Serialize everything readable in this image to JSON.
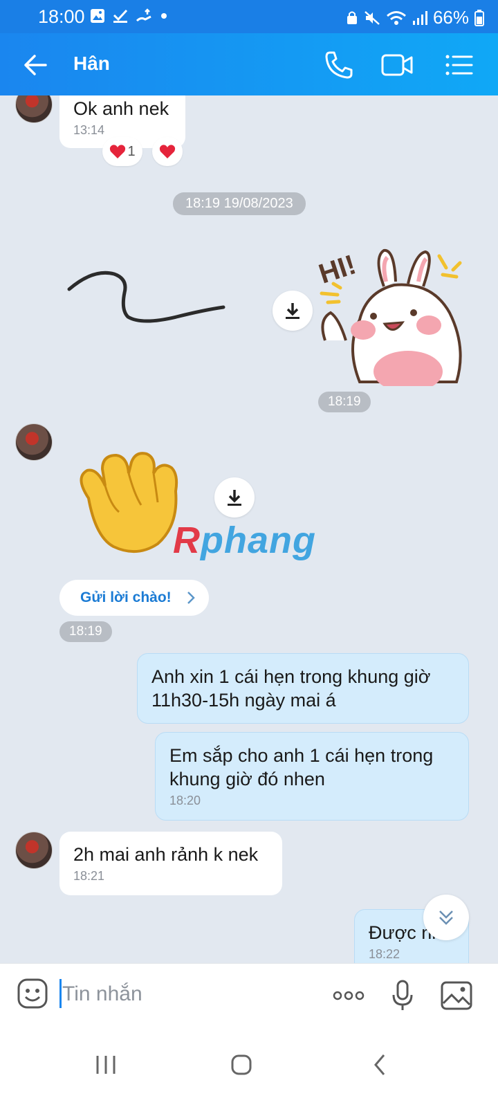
{
  "status_bar": {
    "time": "18:00",
    "battery": "66%"
  },
  "header": {
    "contact_name": "Hân"
  },
  "messages": {
    "m1": {
      "text": "Ok anh nek",
      "time": "13:14",
      "reaction_count": "1"
    },
    "date_divider": "18:19 19/08/2023",
    "sticker_time": "18:19",
    "greet_button": "Gửi lời chào!",
    "greet_time": "18:19",
    "m2": {
      "text": "Anh xin 1 cái hẹn trong khung giờ 11h30-15h ngày mai á"
    },
    "m3": {
      "text": "Em sắp cho anh 1 cái hẹn trong khung giờ đó nhen",
      "time": "18:20"
    },
    "m4": {
      "text": "2h mai anh rảnh k nek",
      "time": "18:21"
    },
    "m5": {
      "text": "Được nha",
      "time": "18:22"
    }
  },
  "watermark": {
    "first": "R",
    "rest": "phang"
  },
  "sticker_text": "HI!",
  "input": {
    "placeholder": "Tin nhắn"
  },
  "colors": {
    "header": "#1a86ef",
    "outgoing_bubble": "#d4ecfc",
    "background": "#e2e8f0"
  }
}
